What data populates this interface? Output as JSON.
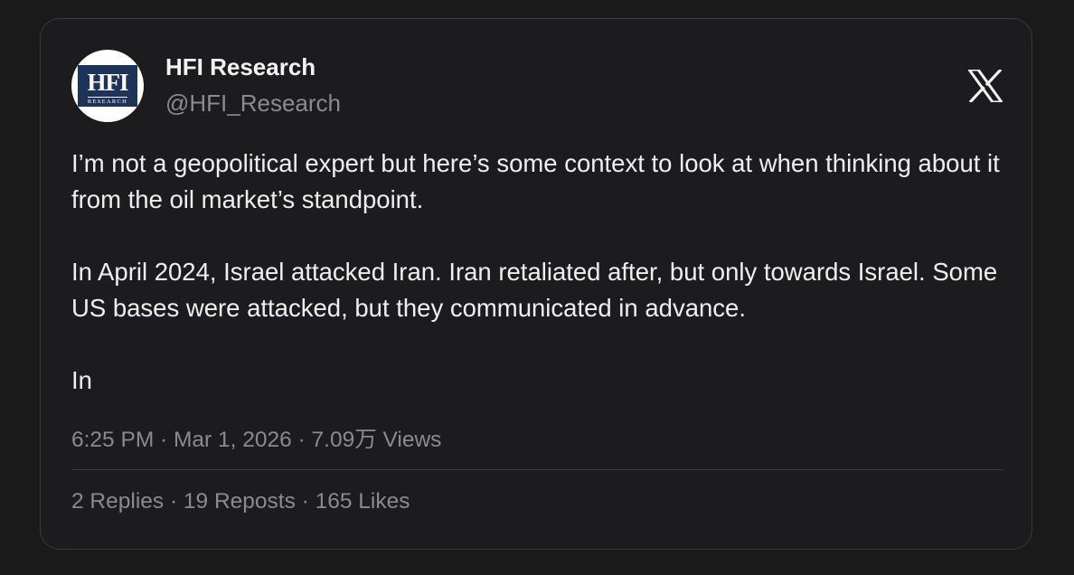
{
  "author": {
    "name": "HFI Research",
    "handle": "@HFI_Research",
    "avatar_logo_text": "HFI",
    "avatar_logo_subtext": "RESEARCH"
  },
  "post": {
    "paragraphs": [
      "I’m not a geopolitical expert but here’s some context to look at when thinking about it from the oil market’s standpoint.",
      "In April 2024, Israel attacked Iran. Iran retaliated after, but only towards Israel. Some US bases were attacked, but they communicated in advance.",
      "In"
    ],
    "meta": "6:25 PM · Mar 1, 2026 · 7.09万 Views",
    "stats": "2 Replies · 19 Reposts · 165 Likes"
  },
  "icons": {
    "platform": "x-logo-icon"
  },
  "colors": {
    "background": "#1a1a1b",
    "card": "#1c1c1e",
    "border": "#3a3a3c",
    "primary_text": "#efefef",
    "secondary_text": "#8b8b8f",
    "logo_navy": "#1d3357"
  }
}
